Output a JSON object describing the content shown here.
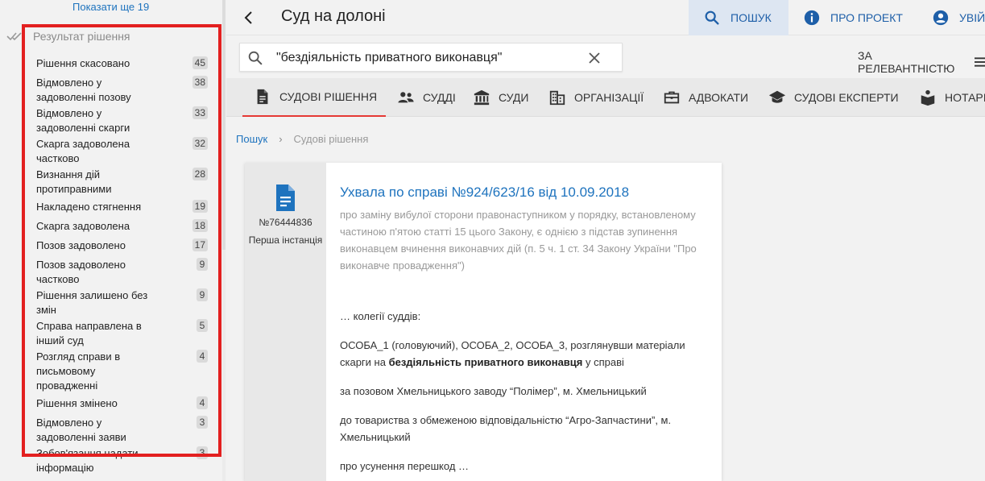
{
  "sidebar": {
    "show_more": "Показати ще 19",
    "group_title": "Результат рішення",
    "facets": [
      {
        "label": "Рішення скасовано",
        "count": "45"
      },
      {
        "label": "Відмовлено у задоволенні позову",
        "count": "38"
      },
      {
        "label": "Відмовлено у задоволенні скарги",
        "count": "33"
      },
      {
        "label": "Скарга задоволена частково",
        "count": "32"
      },
      {
        "label": "Визнання дій протиправними",
        "count": "28"
      },
      {
        "label": "Накладено стягнення",
        "count": "19"
      },
      {
        "label": "Скарга задоволена",
        "count": "18"
      },
      {
        "label": "Позов задоволено",
        "count": "17"
      },
      {
        "label": "Позов задоволено частково",
        "count": "9"
      },
      {
        "label": "Рішення залишено без змін",
        "count": "9"
      },
      {
        "label": "Справа направлена в інший суд",
        "count": "5"
      },
      {
        "label": "Розгляд справи в письмовому провадженні",
        "count": "4"
      },
      {
        "label": "Рішення змінено",
        "count": "4"
      },
      {
        "label": "Відмовлено у задоволенні заяви",
        "count": "3"
      },
      {
        "label": "Зобов'язання надати інформацію",
        "count": "3"
      }
    ]
  },
  "header": {
    "title": "Суд на долоні",
    "nav": {
      "search": "ПОШУК",
      "about": "ПРО ПРОЕКТ",
      "login": "УВІЙТИ"
    }
  },
  "search": {
    "query": "\"бездіяльність приватного виконавця\"",
    "sort_label": "ЗА РЕЛЕВАНТНІСТЮ"
  },
  "tabs": [
    {
      "label": "СУДОВІ РІШЕННЯ",
      "icon": "document-icon"
    },
    {
      "label": "СУДДІ",
      "icon": "people-icon"
    },
    {
      "label": "СУДИ",
      "icon": "court-building-icon"
    },
    {
      "label": "ОРГАНІЗАЦІЇ",
      "icon": "office-building-icon"
    },
    {
      "label": "АДВОКАТИ",
      "icon": "briefcase-icon"
    },
    {
      "label": "СУДОВІ ЕКСПЕРТИ",
      "icon": "graduation-cap-icon"
    },
    {
      "label": "НОТАРІУСИ",
      "icon": "book-reader-icon"
    }
  ],
  "breadcrumb": {
    "home": "Пошук",
    "current": "Судові рішення"
  },
  "result": {
    "doc_number": "№76444836",
    "instance": "Перша інстанція",
    "title": "Ухвала по справі №924/623/16 від 10.09.2018",
    "summary": "про заміну вибулої сторони правонаступником у порядку, встановленому частиною п'ятою статті 15 цього Закону, є однією з підстав зупинення виконавцем вчинення виконавчих дій (п. 5 ч. 1 ст. 34 Закону України \"Про виконавче провадження\")",
    "excerpt_1": "… колегії суддів:",
    "excerpt_2_before": "ОСОБА_1 (головуючий), ОСОБА_2, ОСОБА_3, розглянувши матеріали скарги на ",
    "excerpt_2_bold": "бездіяльність приватного виконавця",
    "excerpt_2_after": " у справі",
    "excerpt_3": "за позовом Хмельницького заводу “Полімер”, м. Хмельницький",
    "excerpt_4": "до товариства з обмеженою відповідальністю “Агро-Запчастини”, м. Хмельницький",
    "excerpt_5": "про усунення перешкод …"
  },
  "colors": {
    "accent": "#1e73be",
    "highlight": "#e32020",
    "active_tab_underline": "#e53935"
  }
}
